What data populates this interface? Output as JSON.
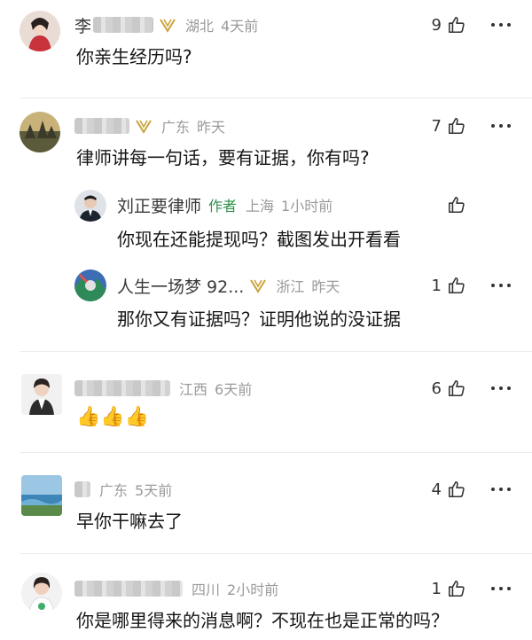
{
  "comments": [
    {
      "name_prefix": "李",
      "location": "湖北",
      "time": "4天前",
      "likes": "9",
      "text": "你亲生经历吗?"
    },
    {
      "location": "广东",
      "time": "昨天",
      "likes": "7",
      "text": "律师讲每一句话，要有证据，你有吗?",
      "replies": [
        {
          "name": "刘正要律师",
          "author_tag": "作者",
          "location": "上海",
          "time": "1小时前",
          "likes": "",
          "text": "你现在还能提现吗？截图发出开看看"
        },
        {
          "name": "人生一场梦 92...",
          "location": "浙江",
          "time": "昨天",
          "likes": "1",
          "text": "那你又有证据吗？证明他说的没证据"
        }
      ]
    },
    {
      "location": "江西",
      "time": "6天前",
      "likes": "6",
      "text": "👍👍👍"
    },
    {
      "location": "广东",
      "time": "5天前",
      "likes": "4",
      "text": "早你干嘛去了"
    },
    {
      "location": "四川",
      "time": "2小时前",
      "likes": "1",
      "text": "你是哪里得来的消息啊？不现在也是正常的吗？"
    }
  ],
  "icons": {
    "like": "thumbs-up-outline-icon",
    "more": "more-horizontal-icon",
    "vip": "vip-badge-icon"
  },
  "colors": {
    "author_tag": "#2f8f4a",
    "vip_gold": "#c9a23a",
    "meta_gray": "#9a9a9a"
  }
}
